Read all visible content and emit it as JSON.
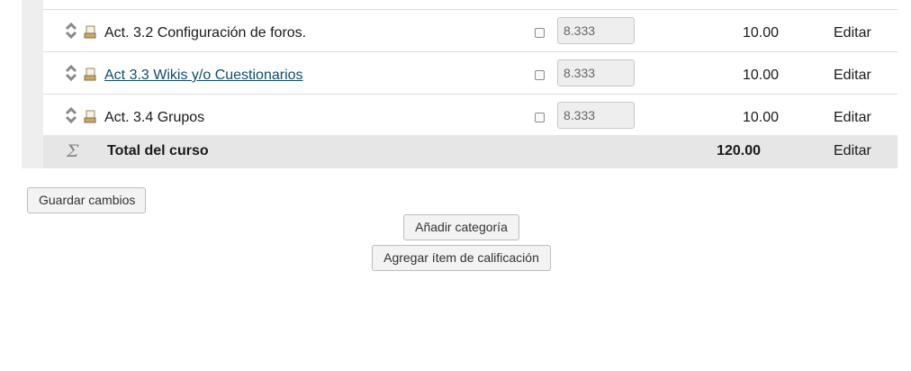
{
  "rows": [
    {
      "name": "Act. 3.2 Configuración de foros.",
      "weight": "8.333",
      "max": "10.00",
      "action": "Editar",
      "is_link": false
    },
    {
      "name": "Act 3.3 Wikis y/o Cuestionarios",
      "weight": "8.333",
      "max": "10.00",
      "action": "Editar",
      "is_link": true
    },
    {
      "name": "Act. 3.4 Grupos",
      "weight": "8.333",
      "max": "10.00",
      "action": "Editar",
      "is_link": false
    }
  ],
  "total": {
    "icon": "sigma-icon",
    "symbol": "Σ",
    "label": "Total del curso",
    "max": "120.00",
    "action": "Editar"
  },
  "buttons": {
    "save": "Guardar cambios",
    "add_category": "Añadir categoría",
    "add_item": "Agregar ítem de calificación"
  },
  "colors": {
    "link": "#0f4d6e",
    "total_row_bg": "#e6e6e6",
    "button_bg": "#f3f3f3"
  }
}
